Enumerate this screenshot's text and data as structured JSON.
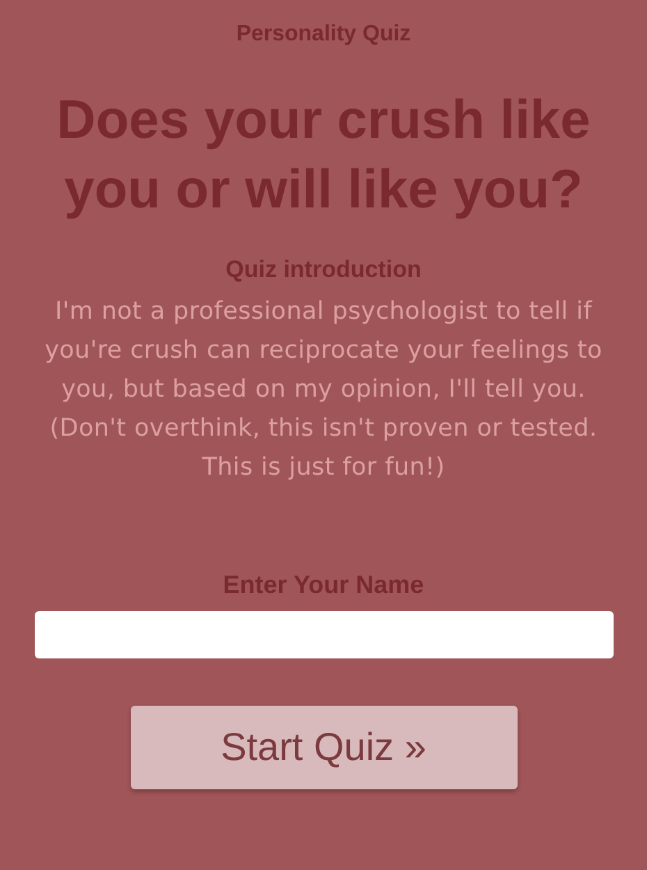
{
  "header": {
    "label": "Personality Quiz"
  },
  "title": "Does your crush like you or will like you?",
  "introduction": {
    "heading": "Quiz introduction",
    "text": "I'm not a professional psychologist to tell if you're crush can reciprocate your feelings to you, but based on my opinion, I'll tell you. (Don't overthink, this isn't proven or tested. This is just for fun!)"
  },
  "name_field": {
    "label": "Enter Your Name"
  },
  "buttons": [
    "Start Quiz »"
  ]
}
